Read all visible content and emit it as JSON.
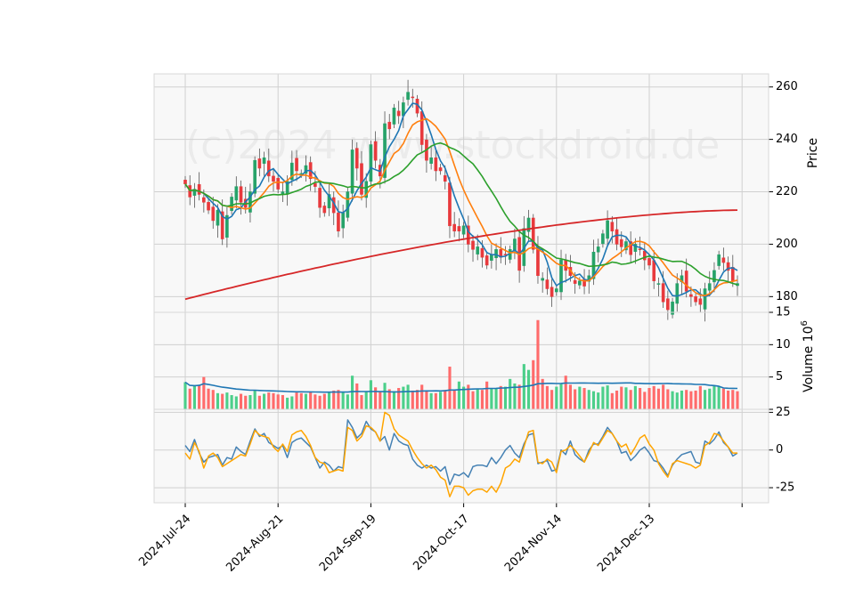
{
  "watermark": "(c)2024 www.stockdroid.de",
  "chart_data": {
    "type": "candlestick",
    "panels": [
      {
        "name": "price",
        "ylabel": "Price",
        "ylim": [
          174,
          265
        ],
        "yticks": [
          180,
          200,
          220,
          240,
          260
        ]
      },
      {
        "name": "volume",
        "ylabel": "Volume  10^6",
        "ylabel_main": "Volume",
        "ylabel_exp": "6",
        "ylabel_base": "10",
        "ylim": [
          0,
          15
        ],
        "yticks": [
          0,
          5,
          10,
          15
        ],
        "ytick_labels": [
          "",
          "5",
          "10",
          "15"
        ]
      },
      {
        "name": "oscillator",
        "ylim": [
          -35,
          27
        ],
        "yticks": [
          -25,
          0,
          25
        ]
      }
    ],
    "x_tick_labels": [
      "2024-Jul-24",
      "2024-Aug-21",
      "2024-Sep-19",
      "2024-Oct-17",
      "2024-Nov-14",
      "2024-Dec-13"
    ],
    "x_tick_index": [
      0,
      20,
      40,
      60,
      80,
      100
    ],
    "n_bars": 120,
    "colors": {
      "up": "#26a269",
      "down": "#e8393c",
      "up_volume": "#4ccf8a",
      "down_volume": "#ff6b6b",
      "ma_short": "#1f77b4",
      "ma_mid": "#ff7f0e",
      "ma_long": "#2ca02c",
      "ma_200": "#d62728",
      "volume_ma": "#1f77b4",
      "osc_fast": "#4682b4",
      "osc_slow": "#ffa500"
    },
    "close": [
      223,
      218,
      221,
      219,
      216,
      213,
      209,
      213,
      202,
      211,
      218,
      222,
      216,
      214,
      220,
      232,
      229,
      233,
      226,
      224,
      221,
      220,
      224,
      231,
      228,
      227,
      230,
      225,
      222,
      214,
      212,
      219,
      212,
      205,
      212,
      220,
      236,
      229,
      219,
      224,
      238,
      232,
      226,
      246,
      244,
      252,
      249,
      254,
      258,
      256,
      250,
      238,
      232,
      233,
      228,
      228,
      224,
      207,
      205,
      205,
      207,
      200,
      198,
      199,
      195,
      192,
      196,
      198,
      195,
      196,
      198,
      202,
      190,
      206,
      210,
      198,
      188,
      187,
      183,
      180,
      183,
      194,
      190,
      188,
      185,
      186,
      184,
      188,
      197,
      199,
      204,
      209,
      205,
      200,
      199,
      201,
      196,
      200,
      198,
      194,
      192,
      186,
      185,
      178,
      175,
      178,
      185,
      188,
      182,
      180,
      178,
      177,
      183,
      185,
      190,
      196,
      193,
      190,
      186,
      185
    ],
    "volume": [
      4.2,
      3.2,
      3.6,
      3.8,
      5.0,
      3.2,
      3.0,
      2.5,
      2.4,
      2.6,
      2.2,
      2.0,
      2.4,
      2.1,
      2.2,
      3.0,
      2.1,
      2.4,
      2.6,
      2.5,
      2.3,
      2.2,
      1.8,
      2.0,
      2.6,
      2.5,
      2.4,
      2.7,
      2.3,
      2.1,
      2.4,
      2.7,
      2.9,
      3.0,
      2.7,
      2.3,
      5.2,
      4.0,
      2.2,
      2.8,
      4.5,
      3.4,
      2.8,
      4.1,
      3.1,
      2.8,
      3.3,
      3.5,
      3.8,
      2.9,
      3.0,
      3.8,
      2.8,
      2.5,
      2.5,
      2.7,
      3.0,
      6.6,
      3.0,
      4.3,
      3.5,
      3.8,
      2.8,
      3.1,
      3.0,
      4.3,
      3.3,
      3.2,
      3.6,
      3.5,
      4.7,
      4.0,
      3.8,
      7.0,
      6.1,
      7.6,
      13.8,
      4.7,
      3.6,
      3.0,
      3.5,
      3.9,
      5.2,
      3.8,
      3.1,
      3.5,
      3.3,
      3.0,
      2.8,
      2.6,
      3.5,
      3.7,
      2.5,
      2.9,
      3.5,
      3.4,
      3.0,
      3.6,
      3.3,
      2.7,
      3.3,
      3.6,
      3.2,
      3.8,
      3.1,
      2.8,
      2.6,
      2.9,
      3.0,
      2.8,
      2.9,
      3.6,
      3.0,
      3.2,
      3.6,
      3.5,
      3.2,
      2.9,
      3.0,
      2.8
    ],
    "osc_fast": [
      3,
      -1,
      7,
      -2,
      -8,
      -5,
      -4,
      -3,
      -10,
      -5,
      -6,
      2,
      -1,
      -3,
      6,
      14,
      9,
      11,
      5,
      3,
      1,
      3,
      -5,
      5,
      7,
      8,
      5,
      2,
      -5,
      -12,
      -8,
      -10,
      -14,
      -11,
      -12,
      20,
      15,
      8,
      11,
      19,
      14,
      12,
      6,
      9,
      0,
      11,
      6,
      4,
      3,
      -6,
      -10,
      -12,
      -10,
      -12,
      -11,
      -14,
      -11,
      -23,
      -16,
      -17,
      -15,
      -18,
      -11,
      -10,
      -10,
      -11,
      -5,
      -9,
      -5,
      0,
      3,
      -2,
      -5,
      4,
      10,
      11,
      -9,
      -8,
      -7,
      -14,
      -13,
      0,
      -3,
      6,
      -3,
      -6,
      -8,
      0,
      4,
      4,
      9,
      15,
      11,
      6,
      -2,
      -1,
      -7,
      -4,
      0,
      2,
      -2,
      -7,
      -8,
      -12,
      -17,
      -10,
      -6,
      -3,
      -2,
      -1,
      -8,
      -9,
      6,
      4,
      7,
      12,
      5,
      2,
      -4,
      -2
    ],
    "osc_slow": [
      -2,
      -6,
      5,
      -1,
      -12,
      -4,
      -2,
      -5,
      -11,
      -9,
      -7,
      -5,
      -3,
      -4,
      4,
      13,
      10,
      9,
      8,
      2,
      -1,
      4,
      -1,
      10,
      12,
      13,
      9,
      3,
      -5,
      -8,
      -9,
      -15,
      -14,
      -13,
      -14,
      15,
      13,
      6,
      9,
      16,
      15,
      12,
      6,
      25,
      23,
      14,
      10,
      8,
      6,
      0,
      -5,
      -9,
      -12,
      -10,
      -13,
      -18,
      -20,
      -31,
      -24,
      -24,
      -25,
      -30,
      -27,
      -26,
      -26,
      -28,
      -24,
      -28,
      -22,
      -12,
      -10,
      -6,
      -8,
      2,
      12,
      13,
      -8,
      -9,
      -6,
      -8,
      -15,
      -1,
      0,
      3,
      0,
      -4,
      -8,
      -2,
      5,
      3,
      8,
      13,
      11,
      6,
      2,
      4,
      -3,
      2,
      8,
      10,
      4,
      0,
      -9,
      -14,
      -18,
      -9,
      -7,
      -8,
      -9,
      -10,
      -12,
      -10,
      3,
      5,
      11,
      10,
      6,
      2,
      -2,
      -2
    ]
  }
}
